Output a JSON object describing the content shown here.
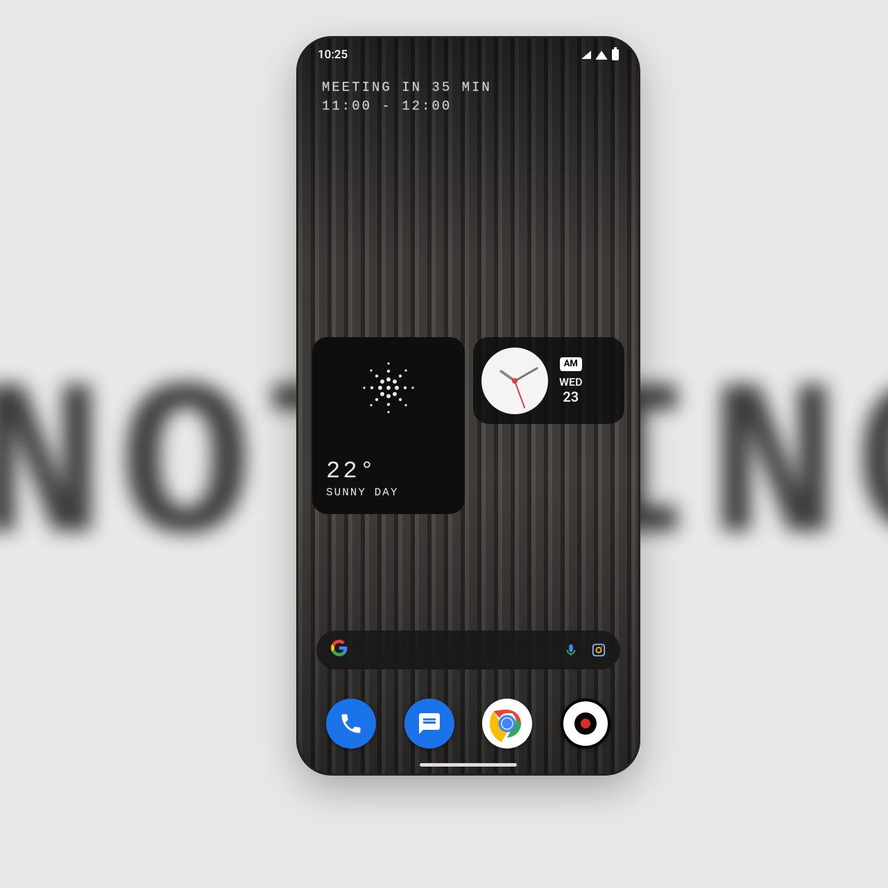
{
  "background": {
    "text": "NOTHING"
  },
  "statusbar": {
    "time": "10:25"
  },
  "calendar": {
    "title": "MEETING IN 35 MIN",
    "time": "11:00 - 12:00"
  },
  "weather": {
    "temp": "22°",
    "desc": "SUNNY DAY"
  },
  "clock": {
    "ampm": "AM",
    "dow": "WED",
    "day": "23"
  },
  "search": {
    "logo": "G"
  },
  "dock": {
    "phone": "Phone",
    "messages": "Messages",
    "chrome": "Chrome",
    "camera": "Camera"
  }
}
